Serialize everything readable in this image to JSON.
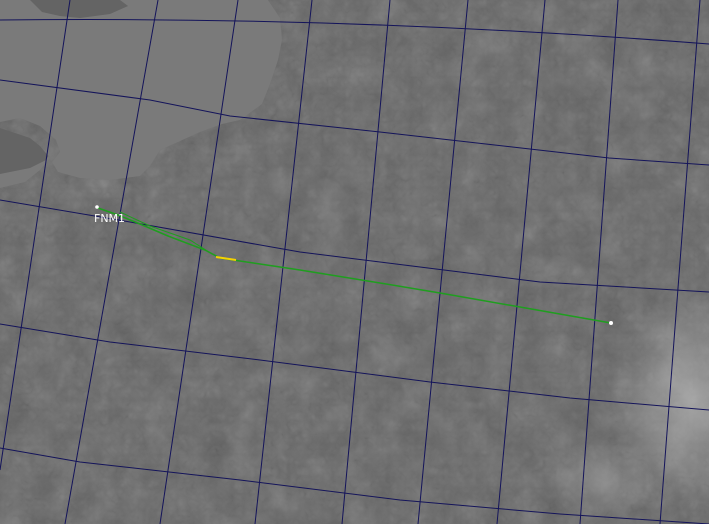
{
  "map": {
    "track_label": "FNM1",
    "colors": {
      "sea": "#7a7a7a",
      "land": "#646464",
      "grid": "#14145a",
      "track": "#1f9e1f",
      "track_highlight": "#f5d200",
      "marker": "#ffffff"
    }
  }
}
